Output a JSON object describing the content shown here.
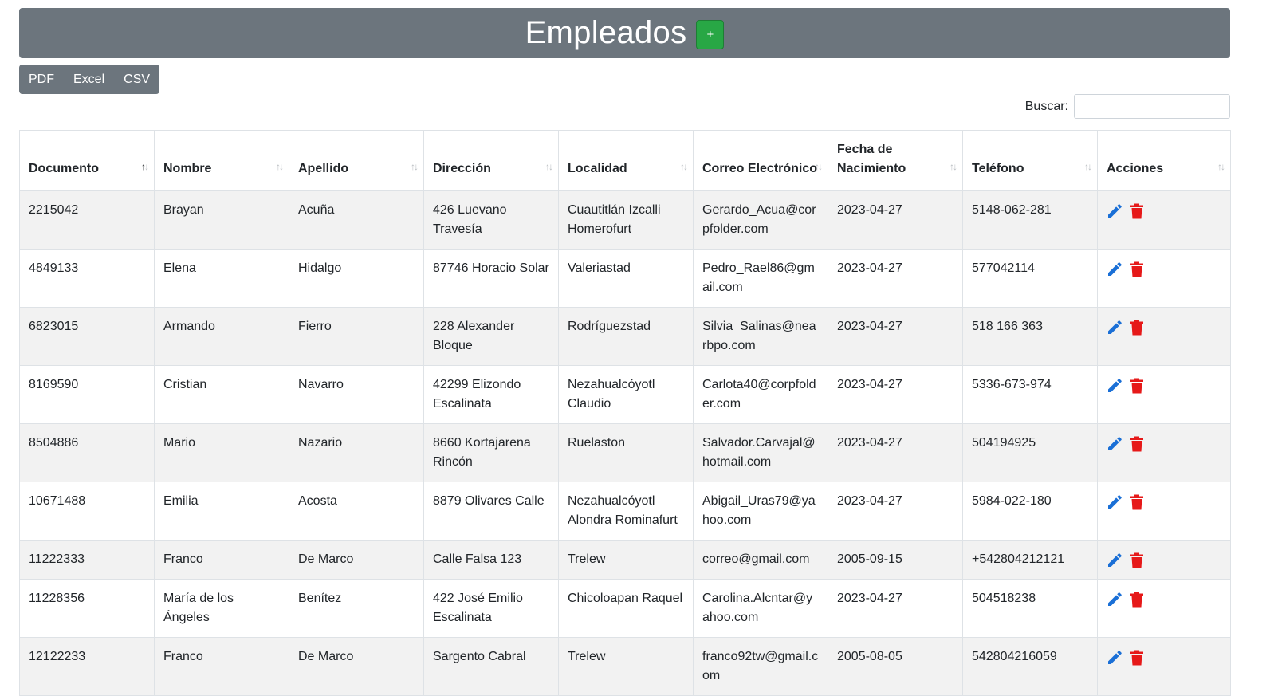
{
  "header": {
    "title": "Empleados",
    "add_label": "+"
  },
  "export": {
    "pdf": "PDF",
    "excel": "Excel",
    "csv": "CSV"
  },
  "search": {
    "label": "Buscar:",
    "value": "",
    "placeholder": ""
  },
  "table": {
    "columns": [
      {
        "label": "Documento",
        "sort": "asc"
      },
      {
        "label": "Nombre",
        "sort": "none"
      },
      {
        "label": "Apellido",
        "sort": "none"
      },
      {
        "label": "Dirección",
        "sort": "none"
      },
      {
        "label": "Localidad",
        "sort": "none"
      },
      {
        "label": "Correo Electrónico",
        "sort": "none"
      },
      {
        "label": "Fecha de Nacimiento",
        "sort": "none"
      },
      {
        "label": "Teléfono",
        "sort": "none"
      },
      {
        "label": "Acciones",
        "sort": "none"
      }
    ],
    "sort_glyph": "↑↓",
    "rows": [
      [
        "2215042",
        "Brayan",
        "Acuña",
        "426 Luevano Travesía",
        "Cuautitlán Izcalli Homerofurt",
        "Gerardo_Acua@corpfolder.com",
        "2023-04-27",
        "5148-062-281"
      ],
      [
        "4849133",
        "Elena",
        "Hidalgo",
        "87746 Horacio Solar",
        "Valeriastad",
        "Pedro_Rael86@gmail.com",
        "2023-04-27",
        "577042114"
      ],
      [
        "6823015",
        "Armando",
        "Fierro",
        "228 Alexander Bloque",
        "Rodríguezstad",
        "Silvia_Salinas@nearbpo.com",
        "2023-04-27",
        "518 166 363"
      ],
      [
        "8169590",
        "Cristian",
        "Navarro",
        "42299 Elizondo Escalinata",
        "Nezahualcóyotl Claudio",
        "Carlota40@corpfolder.com",
        "2023-04-27",
        "5336-673-974"
      ],
      [
        "8504886",
        "Mario",
        "Nazario",
        "8660 Kortajarena Rincón",
        "Ruelaston",
        "Salvador.Carvajal@hotmail.com",
        "2023-04-27",
        "504194925"
      ],
      [
        "10671488",
        "Emilia",
        "Acosta",
        "8879 Olivares Calle",
        "Nezahualcóyotl Alondra Rominafurt",
        "Abigail_Uras79@yahoo.com",
        "2023-04-27",
        "5984-022-180"
      ],
      [
        "11222333",
        "Franco",
        "De Marco",
        "Calle Falsa 123",
        "Trelew",
        "correo@gmail.com",
        "2005-09-15",
        "+542804212121"
      ],
      [
        "11228356",
        "María de los Ángeles",
        "Benítez",
        "422 José Emilio Escalinata",
        "Chicoloapan Raquel",
        "Carolina.Alcntar@yahoo.com",
        "2023-04-27",
        "504518238"
      ],
      [
        "12122233",
        "Franco",
        "De Marco",
        "Sargento Cabral",
        "Trelew",
        "franco92tw@gmail.com",
        "2005-08-05",
        "542804216059"
      ]
    ]
  },
  "icons": {
    "edit": "pencil-icon",
    "delete": "trash-icon",
    "edit_color": "#1a6fd6",
    "delete_color": "#e61919"
  }
}
